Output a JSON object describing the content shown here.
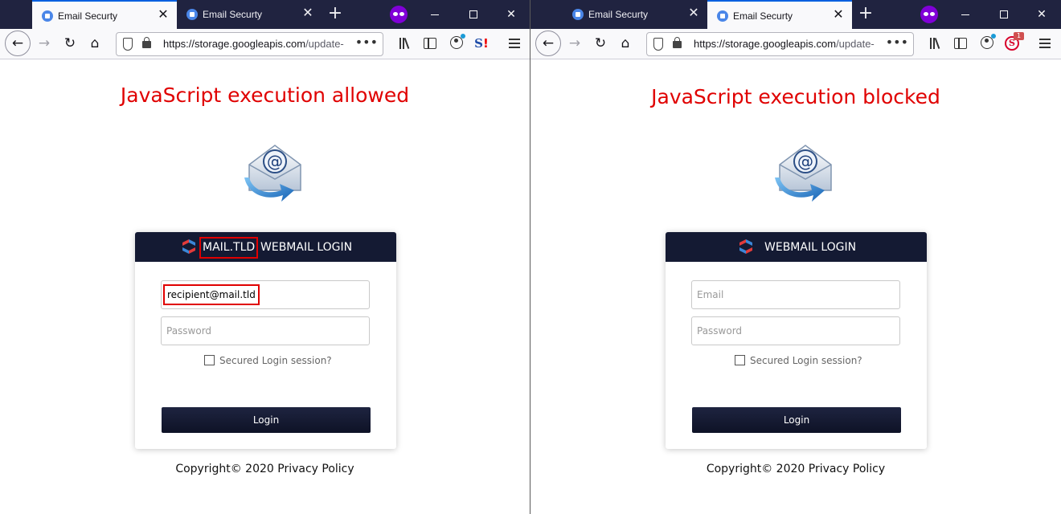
{
  "left": {
    "tabs": [
      {
        "title": "Email Securty",
        "active": true
      },
      {
        "title": "Email Securty",
        "active": false
      }
    ],
    "url": {
      "host": "https://storage.googleapis.com",
      "rest": "/update-"
    },
    "annotation": "JavaScript execution allowed",
    "header": {
      "brand": "MAIL.TLD",
      "title": "WEBMAIL LOGIN"
    },
    "form": {
      "email_value": "recipient@mail.tld",
      "password_placeholder": "Password",
      "secured_label": "Secured Login session?",
      "login_label": "Login"
    },
    "footer": "Copyright© 2020 Privacy Policy"
  },
  "right": {
    "tabs": [
      {
        "title": "Email Securty",
        "active": false
      },
      {
        "title": "Email Securty",
        "active": true
      }
    ],
    "url": {
      "host": "https://storage.googleapis.com",
      "rest": "/update-"
    },
    "annotation": "JavaScript execution blocked",
    "header": {
      "title": "WEBMAIL LOGIN"
    },
    "extension_badge": "1",
    "form": {
      "email_placeholder": "Email",
      "password_placeholder": "Password",
      "secured_label": "Secured Login session?",
      "login_label": "Login"
    },
    "footer": "Copyright© 2020 Privacy Policy"
  },
  "icons": {
    "tab_close": "✕",
    "new_tab": "+",
    "close_window": "✕",
    "back": "←",
    "forward": "→",
    "reload": "↻",
    "home": "⌂",
    "more": "•••"
  },
  "colors": {
    "annotation_red": "#e00000",
    "header_navy": "#141a33",
    "tabstrip": "#202340",
    "private_purple": "#8000d7"
  }
}
